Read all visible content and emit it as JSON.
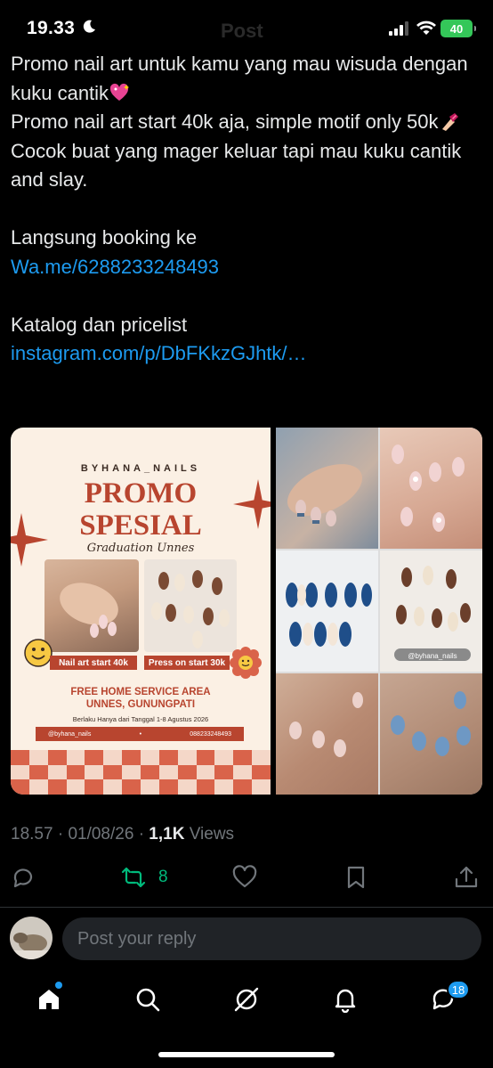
{
  "status_bar": {
    "time": "19.33",
    "ghost_title": "Post",
    "battery": "40"
  },
  "tweet": {
    "lines": [
      "Promo nail art untuk kamu yang mau wisuda dengan kuku cantik",
      "Promo nail art start 40k aja, simple motif only 50k",
      "Cocok buat yang mager keluar tapi mau kuku cantik and slay.",
      "Langsung booking ke",
      "Wa.me/6288233248493",
      "Katalog dan pricelist",
      "instagram.com/p/DbFKkzGJhtk/…"
    ],
    "emoji_1": "sparkling-heart-icon",
    "emoji_2": "nail-polish-icon"
  },
  "poster": {
    "brand": "BYHANA_NAILS",
    "title_1": "PROMO",
    "title_2": "SPESIAL",
    "subtitle": "Graduation Unnes",
    "tag_left": "Nail art start 40k",
    "tag_right": "Press on start 30k",
    "free_line_1": "FREE HOME SERVICE AREA",
    "free_line_2": "UNNES, GUNUNGPATI",
    "validity": "Berlaku Hanya dari Tanggal 1-8 Agustus 2026",
    "instagram": "@byhana_nails",
    "phone": "088233248493"
  },
  "photos": {
    "watermark": "@byhana_nails"
  },
  "meta": {
    "time": "18.57",
    "date": "01/08/26",
    "views_count": "1,1K",
    "views_label": "Views"
  },
  "actions": {
    "retweet_count": "8"
  },
  "reply": {
    "placeholder": "Post your reply"
  },
  "nav": {
    "messages_badge": "18"
  },
  "colors": {
    "link": "#1d9bf0",
    "retweet": "#00ba7c",
    "poster_accent": "#b8452f"
  }
}
